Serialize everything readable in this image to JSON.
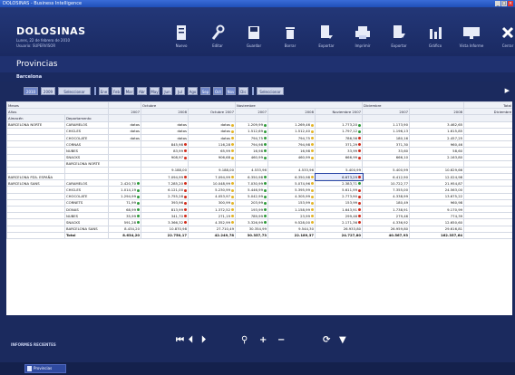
{
  "window": {
    "title": "DOLOSINAS - Business Intelligence"
  },
  "app": {
    "title": "DOLOSINAS",
    "date": "Lunes, 22 de febrero de 2010",
    "user": "Usuario: SUPERVISOR"
  },
  "toolbar": [
    {
      "label": "Nuevo",
      "icon": "new-icon"
    },
    {
      "label": "Editar",
      "icon": "wrench-icon"
    },
    {
      "label": "Guardar",
      "icon": "save-icon"
    },
    {
      "label": "Borrar",
      "icon": "trash-icon"
    },
    {
      "label": "Exportar",
      "icon": "export-icon"
    },
    {
      "label": "Imprimir",
      "icon": "printer-icon"
    },
    {
      "label": "Exportar",
      "icon": "export2-icon"
    },
    {
      "label": "Gráfico",
      "icon": "chart-icon"
    },
    {
      "label": "Vista Informe",
      "icon": "monitor-icon"
    },
    {
      "label": "Cerrar",
      "icon": "close-icon"
    }
  ],
  "section": {
    "title": "Provincias",
    "subtitle": "Barcelona"
  },
  "nav": {
    "buttons": [
      "2010",
      "2009",
      "Seleccionar",
      "Ene",
      "Feb",
      "Mar",
      "Abr",
      "May",
      "Jun",
      "Jul",
      "Ago",
      "Sep",
      "Oct",
      "Nov",
      "Dic",
      "Seleccionar"
    ],
    "active": [
      0,
      11,
      12,
      13
    ]
  },
  "table": {
    "filters": [
      {
        "label": "Meses",
        "value": ""
      },
      {
        "label": "Años",
        "value": ""
      }
    ],
    "row_fields": [
      "Almacén",
      "Departamento"
    ],
    "month_headers": [
      "Octubre",
      "Noviembre",
      "Diciembre",
      "Total"
    ],
    "year_headers": [
      "2007",
      "2008",
      "Octubre 2007",
      "2007",
      "2008",
      "Noviembre 2007",
      "2007",
      "2008",
      "Diciembre",
      "Total"
    ],
    "rows": [
      {
        "a": "BARCELONA NORTE",
        "d": "CARAMELOS",
        "v": [
          "datos",
          "datos",
          "datos",
          "1.209,99",
          "1.269,46",
          "1.773,20",
          "1.173,90",
          "3.462,65"
        ],
        "s": [
          "",
          "",
          "y",
          "g",
          "y",
          "g",
          "",
          ""
        ]
      },
      {
        "a": "",
        "d": "CHICLES",
        "v": [
          "datos",
          "datos",
          "datos",
          "1.512,69",
          "1.512,40",
          "1.797,12",
          "1.196,13",
          "1.615,85"
        ],
        "s": [
          "",
          "",
          "y",
          "g",
          "y",
          "g",
          "",
          ""
        ]
      },
      {
        "a": "",
        "d": "CHOCOLATE",
        "v": [
          "datos",
          "datos",
          "datos",
          "794,75",
          "794,75",
          "786,56",
          "180,16",
          "2.457,25"
        ],
        "s": [
          "",
          "",
          "y",
          "g",
          "y",
          "r",
          "",
          ""
        ]
      },
      {
        "a": "",
        "d": "CORNAS",
        "v": [
          "",
          "845,98",
          "116,28",
          "794,98",
          "794,98",
          "371,29",
          "371,30",
          "960,46"
        ],
        "s": [
          "",
          "r",
          "y",
          "g",
          "y",
          "r",
          "",
          ""
        ]
      },
      {
        "a": "",
        "d": "NUBES",
        "v": [
          "",
          "83,99",
          "65,99",
          "16,98",
          "16,98",
          "33,99",
          "33,60",
          "58,60"
        ],
        "s": [
          "",
          "r",
          "y",
          "g",
          "y",
          "r",
          "",
          ""
        ]
      },
      {
        "a": "",
        "d": "SNACKS",
        "v": [
          "",
          "908,97",
          "906,68",
          "460,99",
          "460,99",
          "666,99",
          "666,10",
          "2.163,80"
        ],
        "s": [
          "",
          "r",
          "y",
          "g",
          "y",
          "r",
          "",
          ""
        ]
      },
      {
        "a": "",
        "d": "BARCELONA NORTE",
        "v": [
          "",
          "",
          "",
          "",
          "",
          "",
          "",
          ""
        ],
        "s": [
          "",
          "",
          "",
          "",
          "",
          "",
          "",
          ""
        ]
      },
      {
        "a": "",
        "d": "",
        "v": [
          "",
          "9.188,00",
          "9.188,00",
          "4.533,96",
          "4.533,96",
          "5.400,99",
          "5.400,99",
          "10.629,66"
        ],
        "s": [
          "",
          "",
          "",
          "",
          "",
          "",
          "",
          ""
        ]
      },
      {
        "a": "BARCELONA PZA. ESPAÑA",
        "d": "",
        "v": [
          "",
          "7.094,99",
          "7.094,99",
          "6.350,98",
          "6.350,98",
          "6.673,29",
          "6.412,90",
          "12.024,98"
        ],
        "s": [
          "",
          "r",
          "y",
          "g",
          "y",
          "r",
          "",
          ""
        ]
      },
      {
        "a": "BARCELONA SANS",
        "d": "CARAMELOS",
        "v": [
          "2.420,70",
          "7.285,20",
          "10.048,99",
          "7.030,99",
          "5.074,96",
          "2.383,71",
          "10.722,77",
          "21.954,87"
        ],
        "s": [
          "g",
          "r",
          "y",
          "g",
          "y",
          "g",
          "",
          ""
        ]
      },
      {
        "a": "",
        "d": "CHICLES",
        "v": [
          "1.014,19",
          "6.121,00",
          "5.230,99",
          "5.446,99",
          "5.395,99",
          "5.611,99",
          "7.355,00",
          "24.563,00"
        ],
        "s": [
          "g",
          "r",
          "y",
          "g",
          "y",
          "r",
          "",
          ""
        ]
      },
      {
        "a": "",
        "d": "CHOCOLATE",
        "v": [
          "1.294,99",
          "2.755,28",
          "4.053,97",
          "5.042,99",
          "4.305,99",
          "2.773,90",
          "4.338,99",
          "13.675,22"
        ],
        "s": [
          "g",
          "r",
          "y",
          "g",
          "y",
          "r",
          "",
          ""
        ]
      },
      {
        "a": "",
        "d": "CORNETS",
        "v": [
          "71,99",
          "393,96",
          "300,99",
          "203,99",
          "153,99",
          "153,99",
          "180,49",
          "960,98"
        ],
        "s": [
          "g",
          "r",
          "y",
          "g",
          "y",
          "r",
          "",
          ""
        ]
      },
      {
        "a": "",
        "d": "DONAS",
        "v": [
          "68,99",
          "813,99",
          "1.372,52",
          "193,99",
          "1.158,99",
          "1.643,91",
          "1.738,91",
          "9.170,99"
        ],
        "s": [
          "g",
          "r",
          "y",
          "g",
          "y",
          "r",
          "",
          ""
        ]
      },
      {
        "a": "",
        "d": "NUBES",
        "v": [
          "35,99",
          "341,70",
          "271,19",
          "789,99",
          "23,99",
          "299,46",
          "279,46",
          "774,39"
        ],
        "s": [
          "g",
          "r",
          "y",
          "g",
          "y",
          "r",
          "",
          ""
        ]
      },
      {
        "a": "",
        "d": "SNACKS",
        "v": [
          "591,28",
          "3.366,32",
          "4.352,99",
          "3.326,99",
          "9.528,00",
          "2.171,36",
          "4.336,92",
          "12.650,60"
        ],
        "s": [
          "g",
          "r",
          "y",
          "g",
          "y",
          "r",
          "",
          ""
        ]
      },
      {
        "a": "",
        "d": "BARCELONA SANS",
        "v": [
          "8.434,20",
          "10.870,98",
          "27.710,49",
          "30.354,99",
          "9.544,30",
          "26.933,80",
          "26.959,80",
          "29.616,81"
        ],
        "s": [
          "",
          "",
          "",
          "",
          "",
          "",
          "",
          ""
        ]
      },
      {
        "a": "",
        "d": "Total",
        "v": [
          "8.634,20",
          "22.750,17",
          "42.249,78",
          "30.357,73",
          "22.189,37",
          "24.727,80",
          "40.567,93",
          "162.357,64"
        ],
        "s": [
          "",
          "",
          "",
          "",
          "",
          "",
          "",
          ""
        ]
      }
    ],
    "selected_cell": {
      "row": 8,
      "col": 5
    }
  },
  "bottom": {
    "label": "INFORMES RECIENTES"
  },
  "taskbar": {
    "label": "Provincias"
  }
}
